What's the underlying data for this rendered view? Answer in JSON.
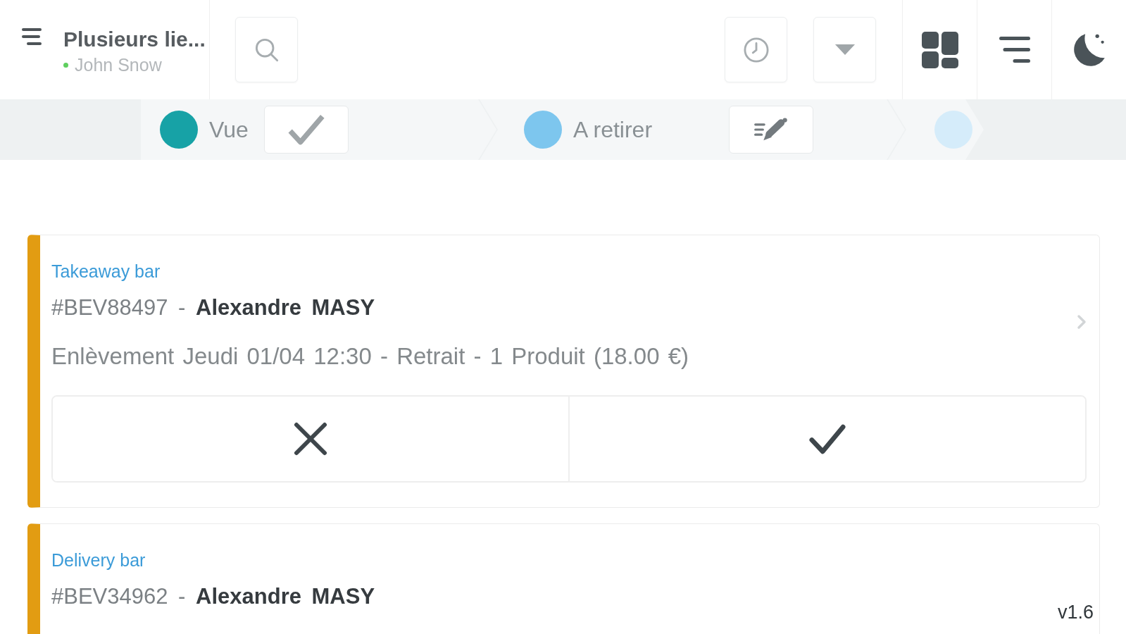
{
  "header": {
    "title": "Plusieurs lie...",
    "user": {
      "name": "John Snow",
      "online": true
    }
  },
  "steps": [
    {
      "label": "Vue",
      "color": "#17a2a6",
      "kind": "check"
    },
    {
      "label": "A retirer",
      "color": "#7dc6ee",
      "kind": "sign"
    },
    {
      "color": "#d5ecfa",
      "kind": "end"
    }
  ],
  "orders": [
    {
      "source": "Takeaway bar",
      "title": "#BEV88497 - **Alexandre MASY**",
      "details": "Enlèvement Jeudi 01/04 12:30 - Retrait - 1 Produit (18.00 €)",
      "actions": [
        {
          "kind": "decline"
        },
        {
          "kind": "accept"
        }
      ]
    },
    {
      "source": "Delivery bar",
      "title": "#BEV34962 - **Alexandre MASY**"
    }
  ],
  "version": "v1.6"
}
